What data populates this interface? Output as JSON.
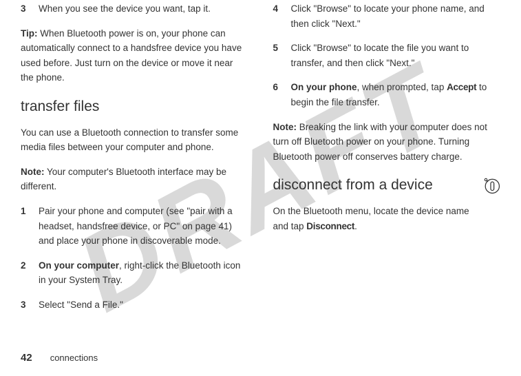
{
  "watermark": "DRAFT",
  "left": {
    "step3": {
      "num": "3",
      "text": "When you see the device you want, tap it."
    },
    "tip_label": "Tip:",
    "tip_text": " When Bluetooth power is on, your phone can automatically connect to a handsfree device you have used before. Just turn on the device or move it near the phone.",
    "heading": "transfer files",
    "intro": "You can use a Bluetooth connection to transfer some media files between your computer and phone.",
    "note_label": "Note:",
    "note_text": " Your computer's Bluetooth interface may be different.",
    "step1": {
      "num": "1",
      "text": "Pair your phone and computer (see \"pair with a headset, handsfree device, or PC\" on page 41) and place your phone in discoverable mode."
    },
    "step2": {
      "num": "2",
      "bold": "On your computer",
      "text": ", right-click the Bluetooth icon in your System Tray."
    },
    "step3b": {
      "num": "3",
      "text": "Select \"Send a File.\""
    }
  },
  "right": {
    "step4": {
      "num": "4",
      "text": "Click \"Browse\" to locate your phone name, and then click \"Next.\""
    },
    "step5": {
      "num": "5",
      "text": "Click \"Browse\" to locate the file you want to transfer, and then click \"Next.\""
    },
    "step6": {
      "num": "6",
      "bold": "On your phone",
      "t1": ", when prompted, tap ",
      "accept": "Accept",
      "t2": " to begin the file transfer."
    },
    "note_label": "Note:",
    "note_text": " Breaking the link with your computer does not turn off Bluetooth power on your phone. Turning Bluetooth power off conserves battery charge.",
    "heading": "disconnect from a device",
    "disc_t1": "On the Bluetooth menu, locate the device name and tap ",
    "disconnect": "Disconnect",
    "disc_t2": "."
  },
  "footer": {
    "page": "42",
    "section": "connections"
  }
}
